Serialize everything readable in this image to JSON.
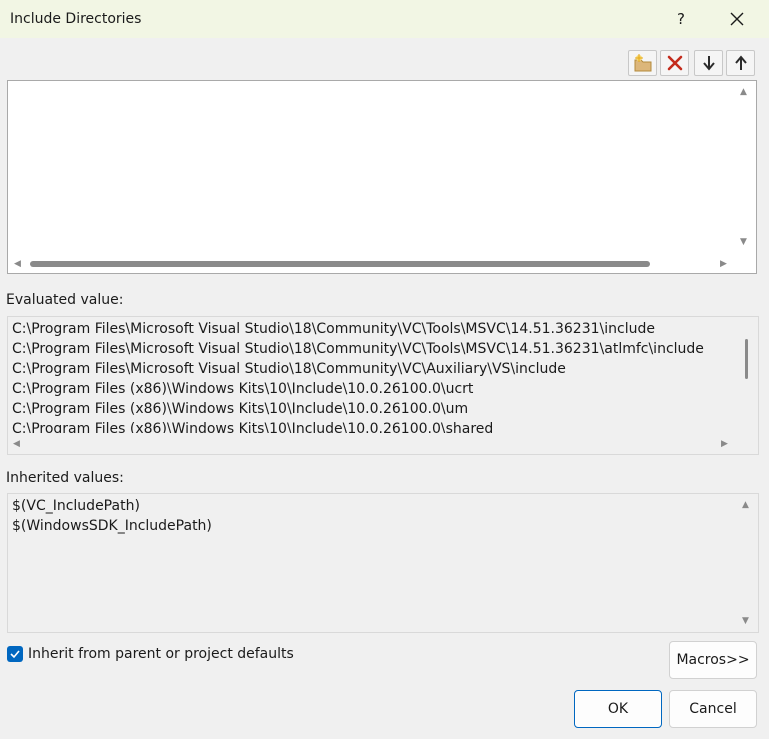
{
  "window": {
    "title": "Include Directories",
    "help_label": "?"
  },
  "toolbar": {
    "buttons": [
      {
        "icon": "new-folder-icon"
      },
      {
        "icon": "delete-icon"
      },
      {
        "icon": "move-down-icon"
      },
      {
        "icon": "move-up-icon"
      }
    ]
  },
  "edit_list": {
    "items": []
  },
  "evaluated": {
    "label": "Evaluated value:",
    "lines": [
      "C:\\Program Files\\Microsoft Visual Studio\\18\\Community\\VC\\Tools\\MSVC\\14.51.36231\\include",
      "C:\\Program Files\\Microsoft Visual Studio\\18\\Community\\VC\\Tools\\MSVC\\14.51.36231\\atlmfc\\include",
      "C:\\Program Files\\Microsoft Visual Studio\\18\\Community\\VC\\Auxiliary\\VS\\include",
      "C:\\Program Files (x86)\\Windows Kits\\10\\Include\\10.0.26100.0\\ucrt",
      "C:\\Program Files (x86)\\Windows Kits\\10\\Include\\10.0.26100.0\\um",
      "C:\\Program Files (x86)\\Windows Kits\\10\\Include\\10.0.26100.0\\shared"
    ]
  },
  "inherited": {
    "label": "Inherited values:",
    "lines": [
      "$(VC_IncludePath)",
      "$(WindowsSDK_IncludePath)"
    ]
  },
  "inherit_checkbox": {
    "label": "Inherit from parent or project defaults",
    "checked": true
  },
  "buttons": {
    "macros": "Macros>>",
    "ok": "OK",
    "cancel": "Cancel"
  },
  "colors": {
    "accent": "#0067c0",
    "titlebar": "#f2f6e4"
  }
}
